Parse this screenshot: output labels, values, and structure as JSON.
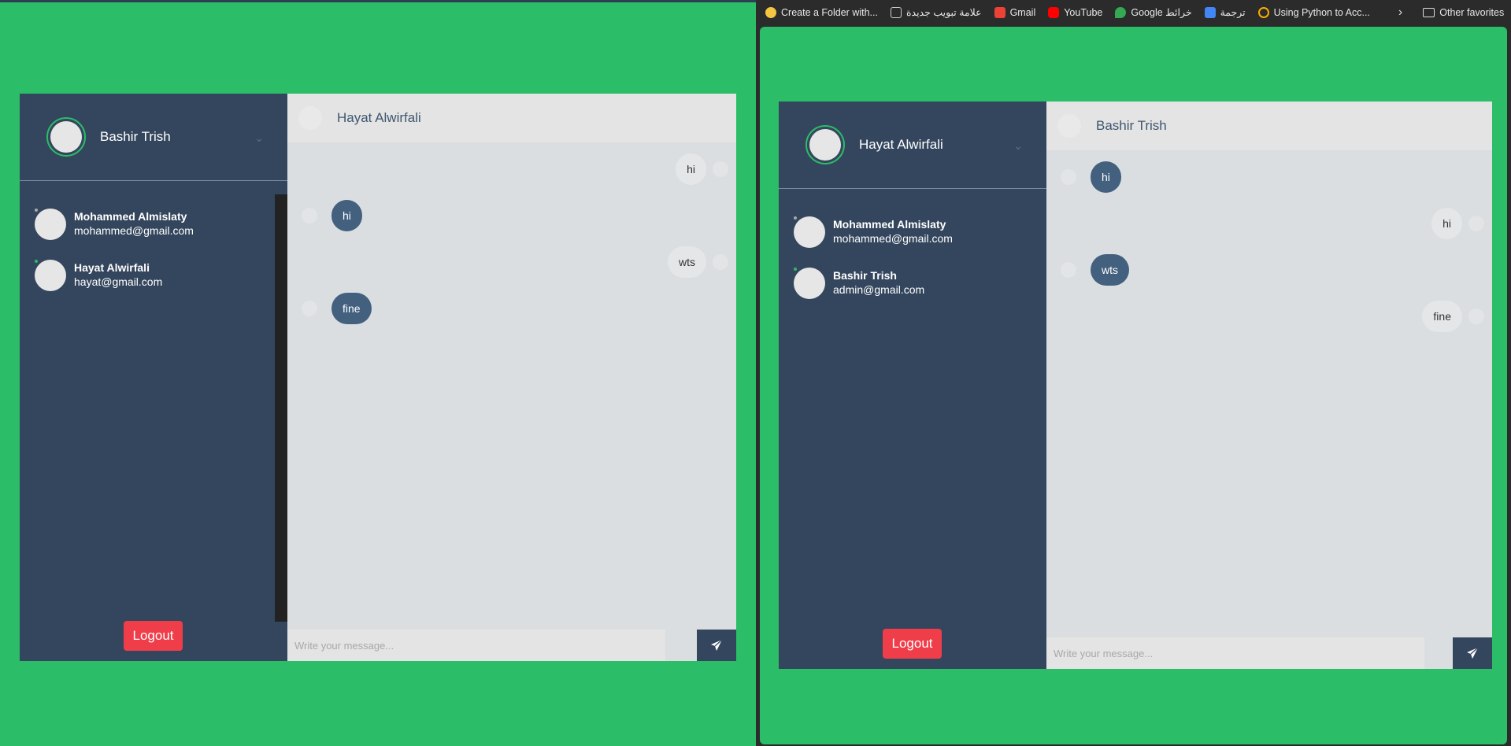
{
  "bookmarks": {
    "items": [
      {
        "label": "Create a Folder with...",
        "icon": "smiley-icon",
        "color": "#f4c542"
      },
      {
        "label": "علامة تبويب جديدة",
        "icon": "newtab-icon",
        "color": "#cccccc"
      },
      {
        "label": "Gmail",
        "icon": "gmail-icon",
        "color": "#ea4335"
      },
      {
        "label": "YouTube",
        "icon": "youtube-icon",
        "color": "#ff0000"
      },
      {
        "label": "Google خرائط",
        "icon": "maps-icon",
        "color": "#34a853"
      },
      {
        "label": "ترجمة",
        "icon": "translate-icon",
        "color": "#4285f4"
      },
      {
        "label": "Using Python to Acc...",
        "icon": "colab-icon",
        "color": "#f9ab00"
      }
    ],
    "more": "›",
    "other": "Other favorites"
  },
  "left": {
    "me": {
      "name": "Bashir Trish"
    },
    "contacts": [
      {
        "name": "Mohammed Almislaty",
        "email": "mohammed@gmail.com",
        "status_color": "#aaaaaa"
      },
      {
        "name": "Hayat Alwirfali",
        "email": "hayat@gmail.com",
        "status_color": "#2bbd68"
      }
    ],
    "logout": "Logout",
    "chat": {
      "title": "Hayat Alwirfali",
      "messages": [
        {
          "dir": "sent",
          "text": "hi"
        },
        {
          "dir": "recv",
          "text": "hi"
        },
        {
          "dir": "sent",
          "text": "wts"
        },
        {
          "dir": "recv",
          "text": "fine"
        }
      ],
      "placeholder": "Write your message..."
    }
  },
  "right": {
    "me": {
      "name": "Hayat Alwirfali"
    },
    "contacts": [
      {
        "name": "Mohammed Almislaty",
        "email": "mohammed@gmail.com",
        "status_color": "#aaaaaa"
      },
      {
        "name": "Bashir Trish",
        "email": "admin@gmail.com",
        "status_color": "#2bbd68"
      }
    ],
    "logout": "Logout",
    "chat": {
      "title": "Bashir Trish",
      "messages": [
        {
          "dir": "recv",
          "text": "hi"
        },
        {
          "dir": "sent",
          "text": "hi"
        },
        {
          "dir": "recv",
          "text": "wts"
        },
        {
          "dir": "sent",
          "text": "fine"
        }
      ],
      "placeholder": "Write your message..."
    }
  },
  "colors": {
    "background": "#2bbd68",
    "sidebar": "#34465d",
    "bubble_recv": "#43607f",
    "logout": "#ef3e4a"
  }
}
